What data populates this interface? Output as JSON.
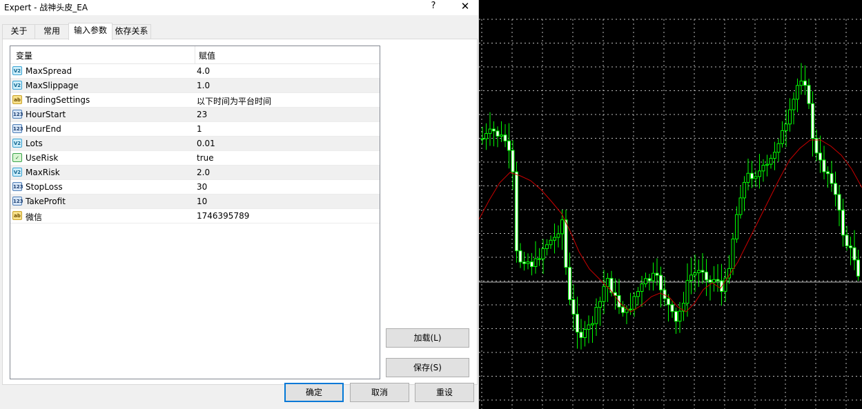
{
  "window": {
    "title": "Expert - 战神头皮_EA",
    "help_label": "?",
    "close_label": "✕"
  },
  "tabs": [
    {
      "label": "关于",
      "active": false
    },
    {
      "label": "常用",
      "active": false
    },
    {
      "label": "输入参数",
      "active": true
    },
    {
      "label": "依存关系",
      "active": false
    }
  ],
  "grid": {
    "columns": [
      "变量",
      "赋值"
    ],
    "rows": [
      {
        "icon": "v2",
        "name": "MaxSpread",
        "value": "4.0"
      },
      {
        "icon": "v2",
        "name": "MaxSlippage",
        "value": "1.0"
      },
      {
        "icon": "ab",
        "name": "TradingSettings",
        "value": "以下时间为平台时间"
      },
      {
        "icon": "n123",
        "name": "HourStart",
        "value": "23"
      },
      {
        "icon": "n123",
        "name": "HourEnd",
        "value": "1"
      },
      {
        "icon": "v2",
        "name": "Lots",
        "value": "0.01"
      },
      {
        "icon": "bool",
        "name": "UseRisk",
        "value": "true"
      },
      {
        "icon": "v2",
        "name": "MaxRisk",
        "value": "2.0"
      },
      {
        "icon": "n123",
        "name": "StopLoss",
        "value": "30"
      },
      {
        "icon": "n123",
        "name": "TakeProfit",
        "value": "10"
      },
      {
        "icon": "ab",
        "name": "微信",
        "value": "1746395789"
      }
    ]
  },
  "buttons": {
    "load": "加载(L)",
    "save": "保存(S)",
    "ok": "确定",
    "cancel": "取消",
    "reset": "重设"
  },
  "icons": {
    "v2": "variable-double-icon",
    "ab": "string-icon",
    "n123": "integer-icon",
    "bool": "boolean-icon"
  },
  "colors": {
    "chart_bg": "#000000",
    "candle": "#00ff00",
    "moving_average": "#cc0000",
    "grid": "#c0c0c0",
    "accent": "#0078d7"
  }
}
